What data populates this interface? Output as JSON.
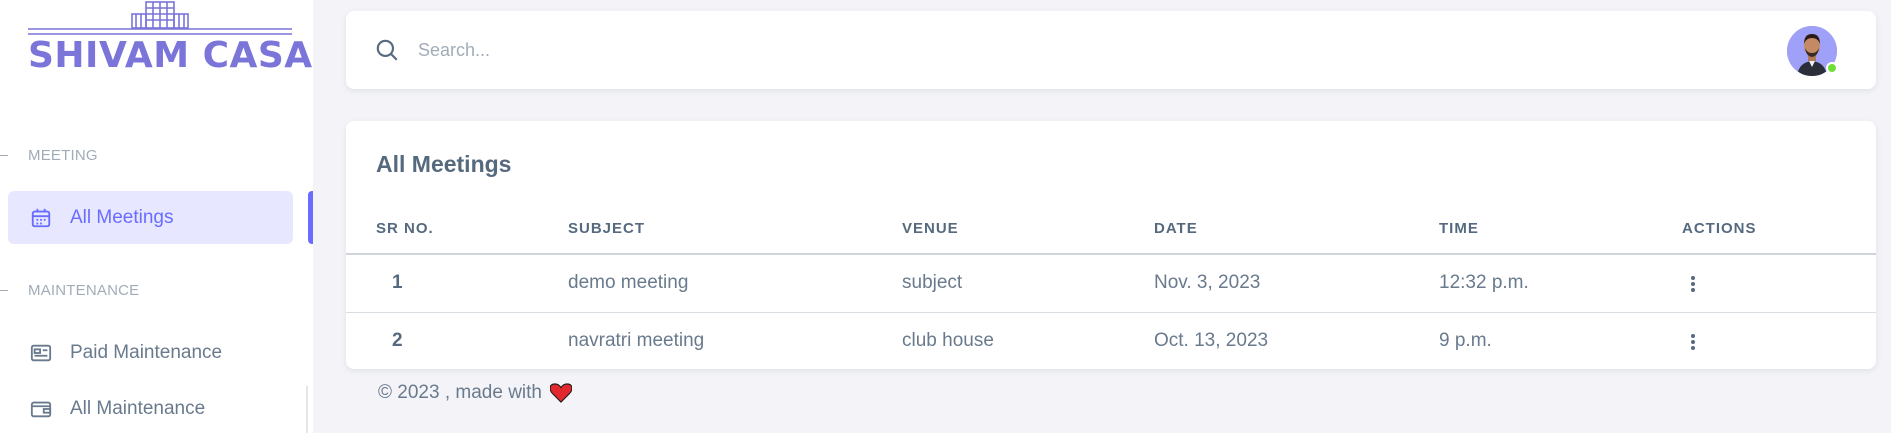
{
  "brand": {
    "name": "SHIVAM CASA",
    "color": "#7b74d9"
  },
  "sidebar": {
    "sections": [
      {
        "header": "MEETING",
        "items": [
          {
            "label": "All Meetings",
            "icon": "calendar-icon",
            "active": true
          }
        ]
      },
      {
        "header": "MAINTENANCE",
        "items": [
          {
            "label": "Paid Maintenance",
            "icon": "id-card-icon",
            "active": false
          },
          {
            "label": "All Maintenance",
            "icon": "wallet-icon",
            "active": false
          }
        ]
      }
    ]
  },
  "navbar": {
    "search_placeholder": "Search...",
    "avatar_status": "online"
  },
  "meetings": {
    "title": "All Meetings",
    "columns": [
      "SR NO.",
      "SUBJECT",
      "VENUE",
      "DATE",
      "TIME",
      "ACTIONS"
    ],
    "rows": [
      {
        "sr": "1",
        "subject": "demo meeting",
        "venue": "subject",
        "date": "Nov. 3, 2023",
        "time": "12:32 p.m."
      },
      {
        "sr": "2",
        "subject": "navratri meeting",
        "venue": "club house",
        "date": "Oct. 13, 2023",
        "time": "9 p.m."
      }
    ]
  },
  "footer": {
    "text": "© 2023 , made with"
  },
  "colors": {
    "accent": "#696cff",
    "accent_bg": "#e7e7ff",
    "status_online": "#71dd37",
    "heart": "#e0282e"
  }
}
